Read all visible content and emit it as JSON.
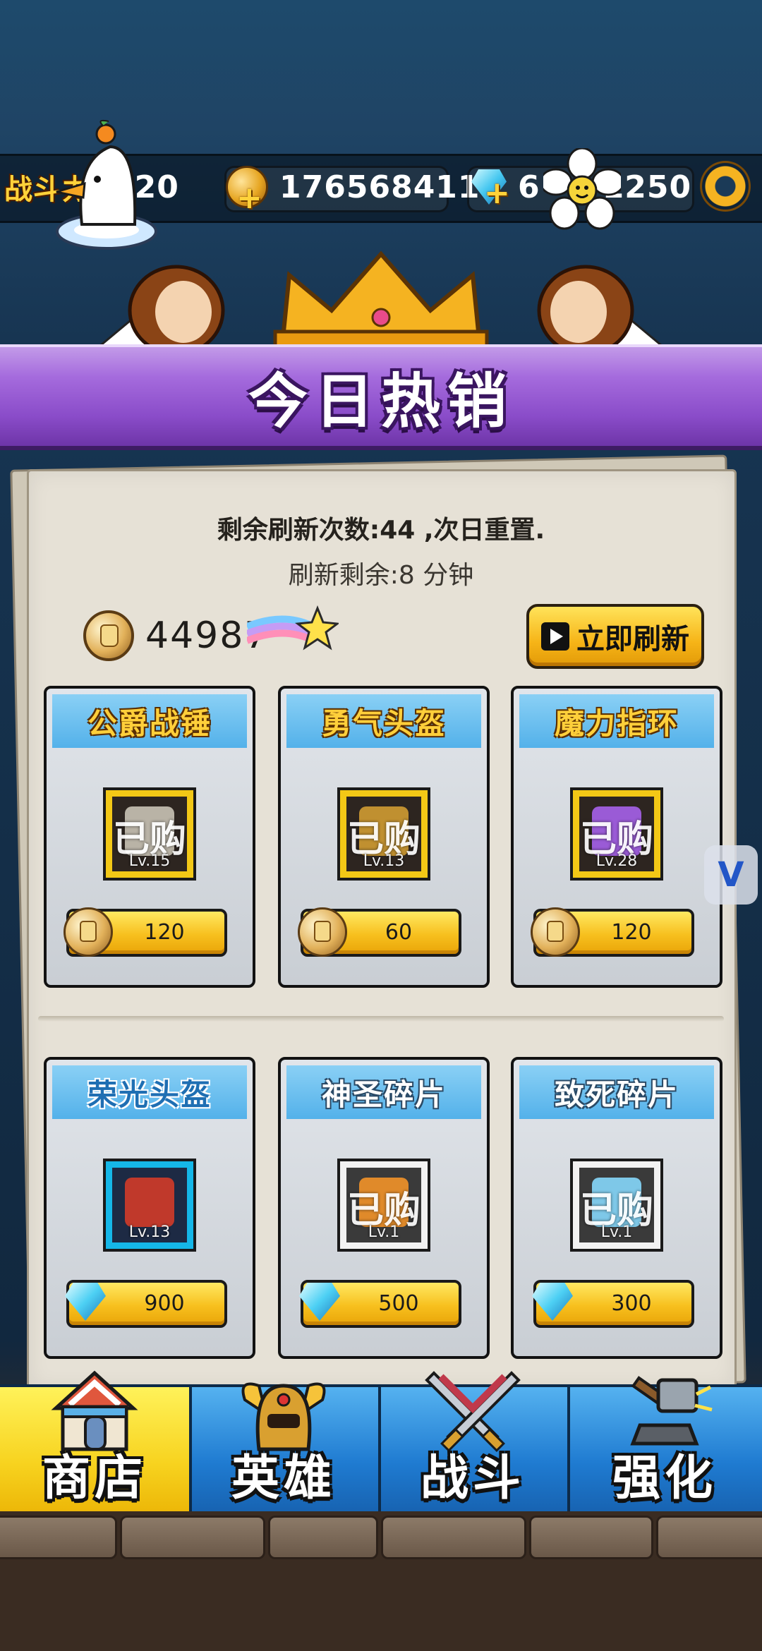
{
  "top_bar": {
    "power_label": "战斗力",
    "power_value": "220",
    "gold_value": "176568411",
    "gem_value": "6",
    "gem_value_suffix": "1250"
  },
  "banner": {
    "title": "今日热销"
  },
  "shop": {
    "refresh_count_text": "剩余刷新次数:44 ,次日重置.",
    "refresh_timer_text": "刷新剩余:8 分钟",
    "currency_value": "44987",
    "refresh_button_label": "立即刷新"
  },
  "items": [
    {
      "name": "公爵战锤",
      "bought": "已购",
      "level": "Lv.15",
      "price": "120",
      "price_icon": "fist-coin-icon",
      "title_style": "gold",
      "frame": "gold"
    },
    {
      "name": "勇气头盔",
      "bought": "已购",
      "level": "Lv.13",
      "price": "60",
      "price_icon": "fist-coin-icon",
      "title_style": "gold",
      "frame": "gold"
    },
    {
      "name": "魔力指环",
      "bought": "已购",
      "level": "Lv.28",
      "price": "120",
      "price_icon": "fist-coin-icon",
      "title_style": "gold",
      "frame": "gold"
    },
    {
      "name": "荣光头盔",
      "bought": "",
      "level": "Lv.13",
      "price": "900",
      "price_icon": "gem-icon",
      "title_style": "blue",
      "frame": "cyan"
    },
    {
      "name": "神圣碎片",
      "bought": "已购",
      "level": "Lv.1",
      "price": "500",
      "price_icon": "gem-icon",
      "title_style": "white",
      "frame": "gray"
    },
    {
      "name": "致死碎片",
      "bought": "已购",
      "level": "Lv.1",
      "price": "300",
      "price_icon": "gem-icon",
      "title_style": "white",
      "frame": "gray"
    }
  ],
  "nav": {
    "tabs": [
      {
        "label": "商店",
        "icon": "shop-house-icon",
        "active": true
      },
      {
        "label": "英雄",
        "icon": "hero-helmet-icon",
        "active": false
      },
      {
        "label": "战斗",
        "icon": "crossed-swords-icon",
        "active": false
      },
      {
        "label": "强化",
        "icon": "hammer-icon",
        "active": false
      }
    ]
  },
  "colors": {
    "banner_purple": "#8a4cc9",
    "nav_active_yellow": "#f7d31f",
    "nav_blue": "#1f7bd1",
    "price_button_yellow": "#f7c01e"
  }
}
